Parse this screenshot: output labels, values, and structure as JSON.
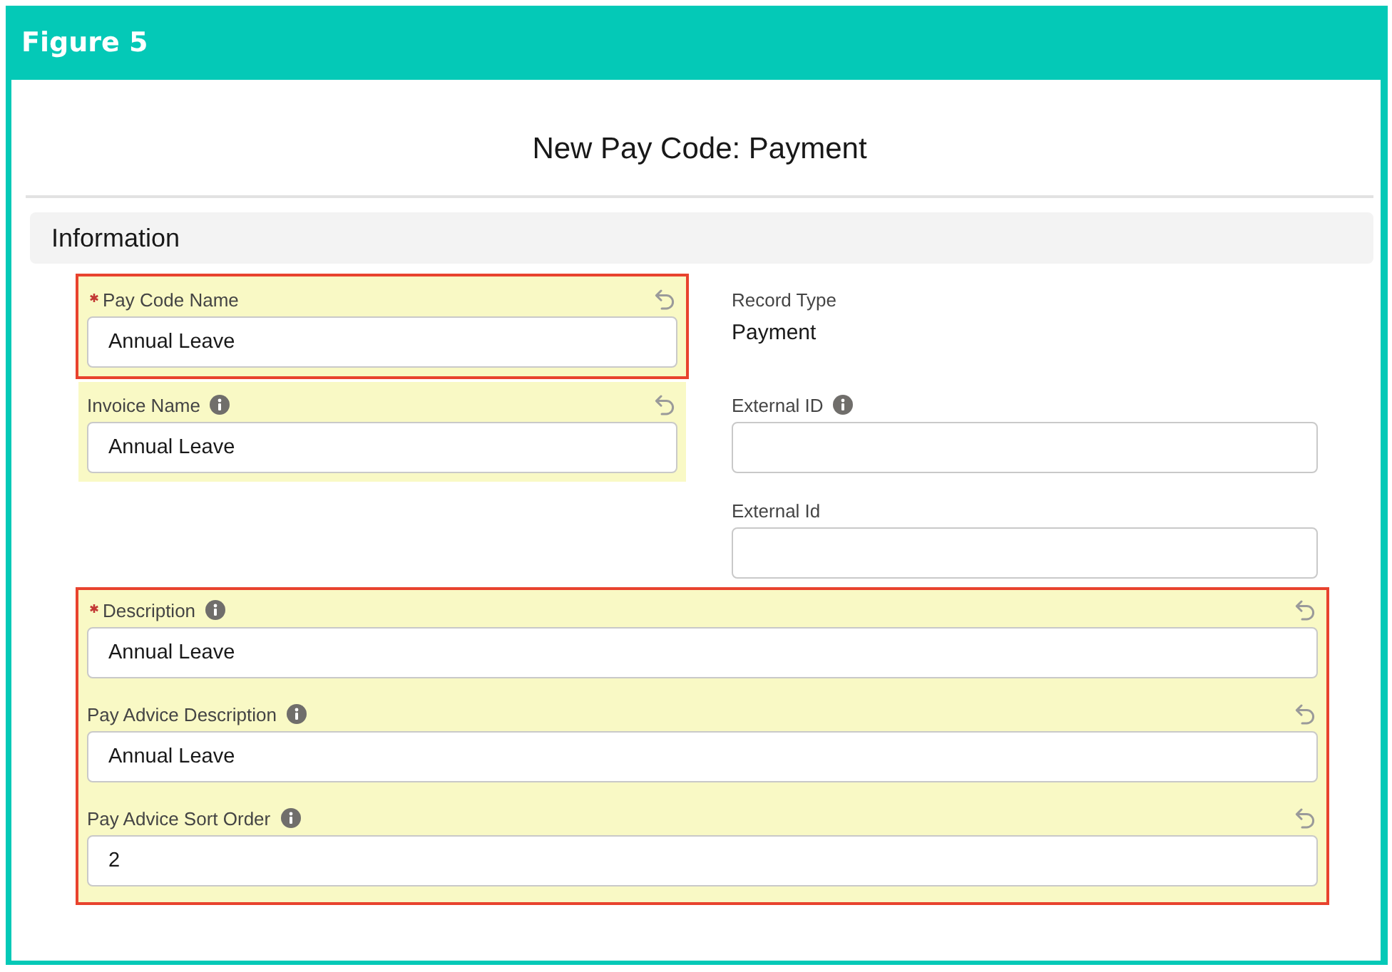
{
  "figure_title": "Figure 5",
  "page_title": "New Pay Code: Payment",
  "section_title": "Information",
  "left_column": [
    {
      "outlined": true,
      "fields": [
        {
          "kind": "input",
          "label": "Pay Code Name",
          "value": "Annual Leave",
          "required": true,
          "help_icon": false,
          "edited": true
        }
      ]
    },
    {
      "outlined": false,
      "fields": [
        {
          "kind": "input",
          "label": "Invoice Name",
          "value": "Annual Leave",
          "required": false,
          "help_icon": true,
          "edited": true
        }
      ]
    }
  ],
  "right_column": [
    {
      "outlined": false,
      "fields": [
        {
          "kind": "readonly",
          "label": "Record Type",
          "value": "Payment",
          "required": false,
          "help_icon": false,
          "edited": false
        }
      ]
    },
    {
      "outlined": false,
      "fields": [
        {
          "kind": "input",
          "label": "External ID",
          "required": false,
          "help_icon": true,
          "edited": false
        }
      ]
    },
    {
      "outlined": false,
      "fields": [
        {
          "kind": "input",
          "label": "External Id",
          "required": false,
          "help_icon": false,
          "edited": false
        }
      ]
    }
  ],
  "full_width": [
    {
      "outlined": true,
      "fields": [
        {
          "kind": "input",
          "label": "Description",
          "value": "Annual Leave",
          "required": true,
          "help_icon": true,
          "edited": true
        },
        {
          "kind": "input",
          "label": "Pay Advice Description",
          "value": "Annual Leave",
          "required": false,
          "help_icon": true,
          "edited": true
        },
        {
          "kind": "input",
          "label": "Pay Advice Sort Order",
          "value": "2",
          "required": false,
          "help_icon": true,
          "edited": true
        }
      ]
    }
  ]
}
